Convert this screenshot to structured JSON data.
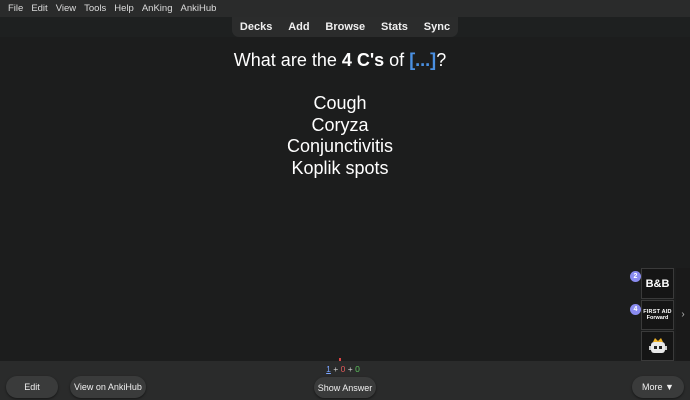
{
  "menubar": {
    "items": [
      "File",
      "Edit",
      "View",
      "Tools",
      "Help",
      "AnKing",
      "AnkiHub"
    ]
  },
  "toolbar": {
    "items": [
      "Decks",
      "Add",
      "Browse",
      "Stats",
      "Sync"
    ]
  },
  "card": {
    "question_prefix": "What are the ",
    "question_bold": "4 C's",
    "question_mid": " of ",
    "cloze": "[...]",
    "question_suffix": "?",
    "answers": [
      "Cough",
      "Coryza",
      "Conjunctivitis",
      "Koplik spots"
    ]
  },
  "sidepanel": {
    "bb_label": "B&B",
    "bb_badge": "2",
    "firstaid_line1": "FIRST AID",
    "firstaid_line2": "Forward",
    "firstaid_badge": "4",
    "arrow": "›"
  },
  "bottombar": {
    "edit_label": "Edit",
    "view_ankihub_label": "View on AnkiHub",
    "show_answer_label": "Show Answer",
    "more_label": "More ▼",
    "counts": {
      "new": "1",
      "learn": "0",
      "review": "0",
      "plus": "+"
    }
  },
  "colors": {
    "background": "#1e2020",
    "cloze": "#4a90e2",
    "count_new": "#7aa4ff",
    "count_learn": "#e05a5a",
    "count_review": "#5ec25e"
  }
}
